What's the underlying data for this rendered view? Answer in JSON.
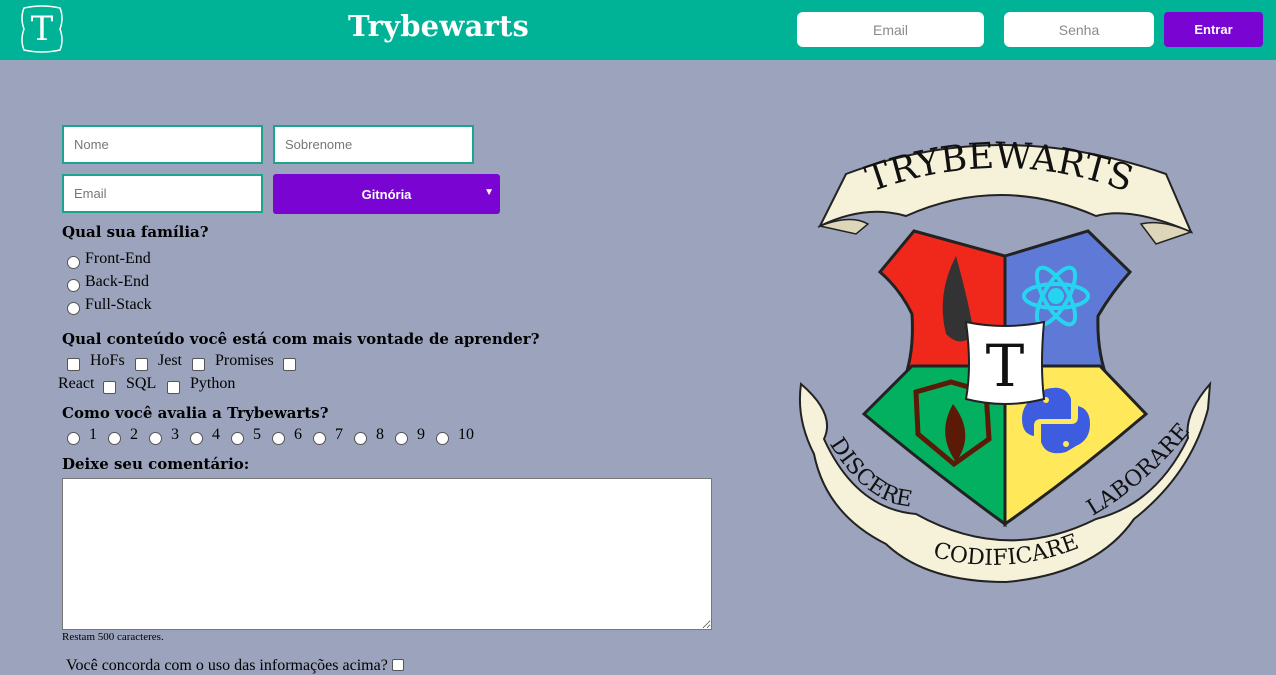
{
  "header": {
    "logo_letter": "T",
    "title": "Trybewarts",
    "email_placeholder": "Email",
    "password_placeholder": "Senha",
    "login_button": "Entrar"
  },
  "form": {
    "name_placeholder": "Nome",
    "lastname_placeholder": "Sobrenome",
    "email_placeholder": "Email",
    "house_selected": "Gitnória",
    "family_question": "Qual sua família?",
    "family_options": [
      "Front-End",
      "Back-End",
      "Full-Stack"
    ],
    "content_question": "Qual conteúdo você está com mais vontade de aprender?",
    "content_options": [
      "HoFs",
      "Jest",
      "Promises",
      "React",
      "SQL",
      "Python"
    ],
    "rating_question": "Como você avalia a Trybewarts?",
    "rating_options": [
      "1",
      "2",
      "3",
      "4",
      "5",
      "6",
      "7",
      "8",
      "9",
      "10"
    ],
    "comment_label": "Deixe seu comentário:",
    "counter_text": "Restam 500 caracteres.",
    "agreement_text": "Você concorda com o uso das informações acima?"
  },
  "crest": {
    "banner_top": "TRYBEWARTS",
    "center_letter": "T",
    "motto_left": "DISCERE",
    "motto_bottom": "CODIFICARE",
    "motto_right": "LABORARE"
  },
  "colors": {
    "header_bg": "#00b296",
    "page_bg": "#9ba4bc",
    "accent_purple": "#7a04d1",
    "crest_red": "#f0281c",
    "crest_blue": "#5f7ad6",
    "crest_green": "#03b060",
    "crest_yellow": "#ffe95a"
  }
}
